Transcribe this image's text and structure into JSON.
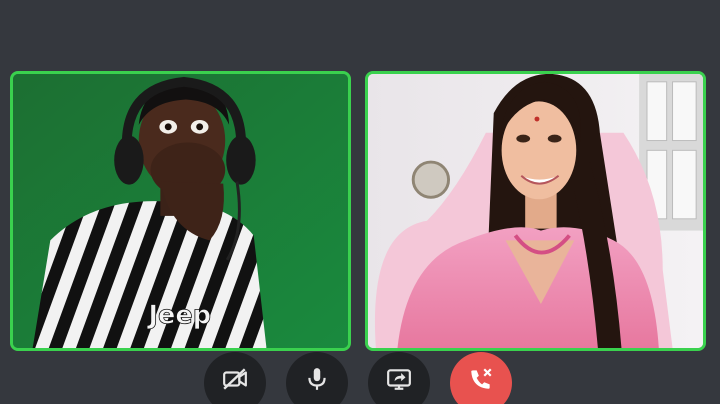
{
  "call": {
    "participants": [
      {
        "speaking": true,
        "jersey_text": "Jeep",
        "background_color": "#1f7a36"
      },
      {
        "speaking": true,
        "background_color": "#ece8ec"
      }
    ],
    "speaking_border_color": "#3ad14e"
  },
  "controls": [
    {
      "icon": "camera-off-icon"
    },
    {
      "icon": "microphone-icon"
    },
    {
      "icon": "screen-share-icon"
    },
    {
      "icon": "end-call-icon",
      "color": "#e8524f"
    }
  ]
}
